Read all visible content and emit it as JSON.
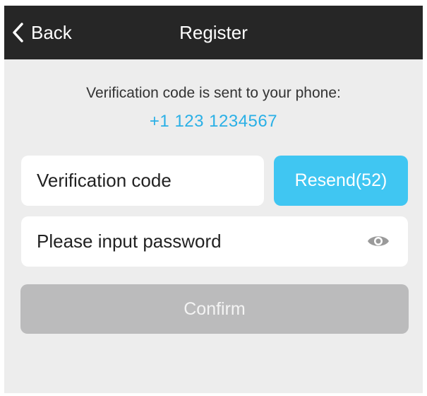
{
  "navbar": {
    "back_label": "Back",
    "title": "Register",
    "back_icon": "chevron-left-icon"
  },
  "verification": {
    "notice": "Verification code is sent to your phone:",
    "phone": "+1 123 1234567"
  },
  "form": {
    "code_placeholder": "Verification code",
    "code_value": "",
    "resend_label": "Resend(52)",
    "password_placeholder": "Please input password",
    "password_value": "",
    "eye_icon": "eye-icon",
    "confirm_label": "Confirm"
  },
  "colors": {
    "navbar_bg": "#262626",
    "background": "#ededed",
    "accent": "#40c6f2",
    "phone_text": "#2ab0e6",
    "confirm_disabled": "#bbbbbc"
  }
}
